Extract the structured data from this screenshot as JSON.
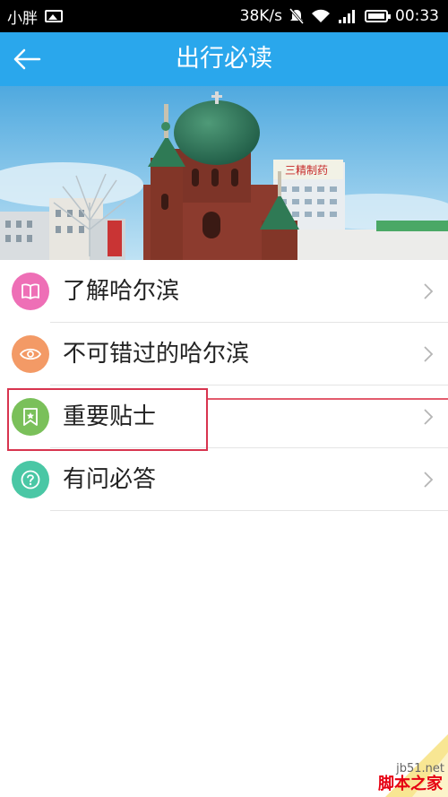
{
  "status_bar": {
    "carrier": "小胖",
    "speed": "38K/s",
    "time": "00:33"
  },
  "header": {
    "title": "出行必读"
  },
  "banner": {
    "sign_text": "三精制药"
  },
  "menu": {
    "items": [
      {
        "label": "了解哈尔滨",
        "icon": "book-icon",
        "color": "#ee6fb6"
      },
      {
        "label": "不可错过的哈尔滨",
        "icon": "eye-icon",
        "color": "#f39a66"
      },
      {
        "label": "重要贴士",
        "icon": "bookmark-icon",
        "color": "#7ac05a"
      },
      {
        "label": "有问必答",
        "icon": "question-icon",
        "color": "#4ac7a5"
      }
    ]
  },
  "watermark": {
    "site": "jb51.net",
    "brand": "脚本之家"
  },
  "colors": {
    "header_bg": "#2aa7ec",
    "highlight": "#d8344f"
  }
}
